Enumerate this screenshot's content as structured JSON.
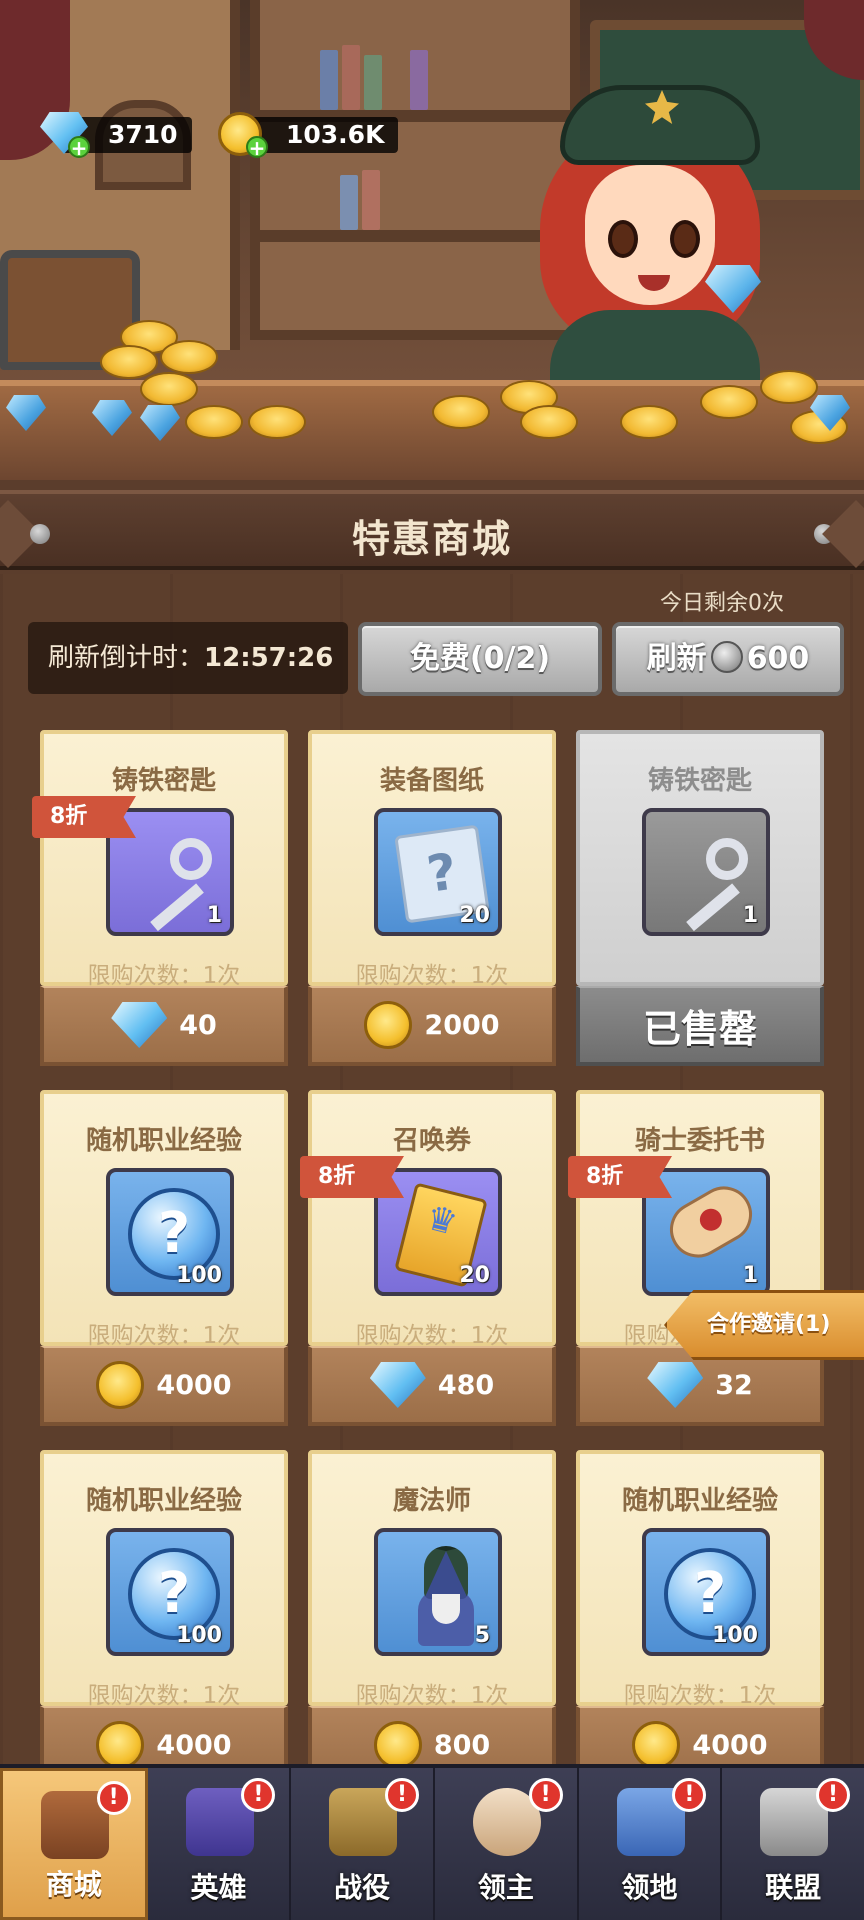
{
  "currency": {
    "gems": "3710",
    "coins": "103.6K",
    "gem_icon": "diamond-icon",
    "coin_icon": "gold-coin-icon"
  },
  "shop": {
    "title": "特惠商城",
    "remaining_today": "今日剩余0次",
    "refresh_timer_label": "刷新倒计时：",
    "refresh_timer_value": "12:57:26",
    "free_button": "免费(0/2)",
    "refresh_button_label": "刷新",
    "refresh_button_cost": "600"
  },
  "cards": [
    {
      "name": "铸铁密匙",
      "count": "1",
      "limit": "限购次数：1次",
      "price": "40",
      "currency": "gem",
      "discount": "8折",
      "icon": "key-icon",
      "sold_out": false
    },
    {
      "name": "装备图纸",
      "count": "20",
      "limit": "限购次数：1次",
      "price": "2000",
      "currency": "coin",
      "discount": "",
      "icon": "blueprint-scroll-icon",
      "sold_out": false
    },
    {
      "name": "铸铁密匙",
      "count": "1",
      "limit": "",
      "price": "已售罄",
      "currency": "",
      "discount": "",
      "icon": "key-icon",
      "sold_out": true
    },
    {
      "name": "随机职业经验",
      "count": "100",
      "limit": "限购次数：1次",
      "price": "4000",
      "currency": "coin",
      "discount": "",
      "icon": "mystery-orb-icon",
      "sold_out": false
    },
    {
      "name": "召唤券",
      "count": "20",
      "limit": "限购次数：1次",
      "price": "480",
      "currency": "gem",
      "discount": "8折",
      "icon": "summon-ticket-icon",
      "sold_out": false
    },
    {
      "name": "骑士委托书",
      "count": "1",
      "limit": "限购次数：1次",
      "price": "32",
      "currency": "gem",
      "discount": "8折",
      "icon": "sealed-letter-icon",
      "sold_out": false
    },
    {
      "name": "随机职业经验",
      "count": "100",
      "limit": "限购次数：1次",
      "price": "4000",
      "currency": "coin",
      "discount": "",
      "icon": "mystery-orb-icon",
      "sold_out": false
    },
    {
      "name": "魔法师",
      "count": "5",
      "limit": "限购次数：1次",
      "price": "800",
      "currency": "coin",
      "discount": "",
      "icon": "wizard-icon",
      "sold_out": false
    },
    {
      "name": "随机职业经验",
      "count": "100",
      "limit": "限购次数：1次",
      "price": "4000",
      "currency": "coin",
      "discount": "",
      "icon": "mystery-orb-icon",
      "sold_out": false
    }
  ],
  "invite": {
    "label": "合作邀请(1)"
  },
  "nav": [
    {
      "label": "商城",
      "icon": "shop-chest-icon",
      "active": true,
      "alert": "!"
    },
    {
      "label": "英雄",
      "icon": "hero-cards-icon",
      "active": false,
      "alert": "!"
    },
    {
      "label": "战役",
      "icon": "crossed-swords-icon",
      "active": false,
      "alert": "!"
    },
    {
      "label": "领主",
      "icon": "lord-crown-icon",
      "active": false,
      "alert": "!"
    },
    {
      "label": "领地",
      "icon": "castle-icon",
      "active": false,
      "alert": "!"
    },
    {
      "label": "联盟",
      "icon": "knight-helmet-icon",
      "active": false,
      "alert": "!"
    }
  ],
  "colors": {
    "discount_badge": "#d0543b",
    "card_bg": "#f3e3b7",
    "price_bar": "#9b6e48",
    "nav_active": "#dfa04a"
  }
}
